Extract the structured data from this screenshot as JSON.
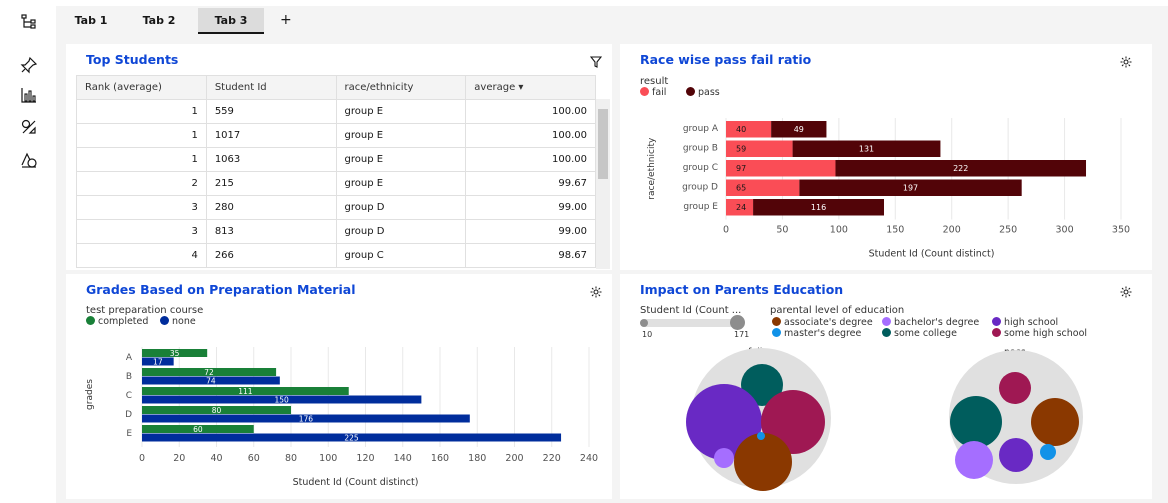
{
  "tabs": [
    {
      "label": "Tab 1"
    },
    {
      "label": "Tab 2"
    },
    {
      "label": "Tab 3"
    }
  ],
  "add_tab": "+",
  "top_students": {
    "title": "Top Students",
    "columns": [
      "Rank (average)",
      "Student Id",
      "race/ethnicity",
      "average ▾"
    ],
    "rows": [
      [
        "1",
        "559",
        "group E",
        "100.00"
      ],
      [
        "1",
        "1017",
        "group E",
        "100.00"
      ],
      [
        "1",
        "1063",
        "group E",
        "100.00"
      ],
      [
        "2",
        "215",
        "group E",
        "99.67"
      ],
      [
        "3",
        "280",
        "group D",
        "99.00"
      ],
      [
        "3",
        "813",
        "group D",
        "99.00"
      ],
      [
        "4",
        "266",
        "group C",
        "98.67"
      ]
    ]
  },
  "race_chart": {
    "title": "Race wise pass fail ratio",
    "legend_title": "result",
    "legend": [
      "fail",
      "pass"
    ]
  },
  "grades_chart": {
    "title": "Grades Based on Preparation Material",
    "legend_title": "test preparation course",
    "legend": [
      "completed",
      "none"
    ]
  },
  "parents_chart": {
    "title": "Impact on Parents Education",
    "slider_label": "Student Id (Count ...",
    "slider_min": "10",
    "slider_max": "171",
    "legend_title": "parental level of education",
    "legend": [
      "associate's degree",
      "bachelor's degree",
      "high school",
      "master's degree",
      "some college",
      "some high school"
    ],
    "facets": [
      "fail",
      "pass"
    ]
  },
  "colors": {
    "fail": "#fa4d56",
    "pass": "#520408",
    "completed": "#198038",
    "none": "#002d9c",
    "associate": "#8a3800",
    "bachelor": "#a56eff",
    "highschool": "#6929c4",
    "master": "#1192e8",
    "college": "#005d5d",
    "somehigh": "#9f1853",
    "title": "#0f47d6"
  },
  "icons": {
    "rail": [
      "data-tree-icon",
      "pin-icon",
      "bar-chart-icon",
      "shapes-icon",
      "dashboard-icon"
    ],
    "panel": [
      "filter-icon",
      "settings-icon"
    ]
  },
  "chart_data": [
    {
      "type": "bar",
      "title": "Race wise pass fail ratio",
      "orientation": "horizontal",
      "stacked": true,
      "categories": [
        "group A",
        "group B",
        "group C",
        "group D",
        "group E"
      ],
      "series": [
        {
          "name": "fail",
          "values": [
            40,
            59,
            97,
            65,
            24
          ]
        },
        {
          "name": "pass",
          "values": [
            49,
            131,
            222,
            197,
            116
          ]
        }
      ],
      "xlabel": "Student Id (Count distinct)",
      "ylabel": "race/ethnicity",
      "xlim": [
        0,
        350
      ],
      "xticks": [
        0,
        50,
        100,
        150,
        200,
        250,
        300,
        350
      ],
      "legend_title": "result",
      "legend_position": "top-left",
      "grid": true
    },
    {
      "type": "bar",
      "title": "Grades Based on Preparation Material",
      "orientation": "horizontal",
      "stacked": false,
      "categories": [
        "A",
        "B",
        "C",
        "D",
        "E"
      ],
      "series": [
        {
          "name": "completed",
          "values": [
            35,
            72,
            111,
            80,
            60
          ]
        },
        {
          "name": "none",
          "values": [
            17,
            74,
            150,
            176,
            225
          ]
        }
      ],
      "xlabel": "Student Id (Count distinct)",
      "ylabel": "grades",
      "xlim": [
        0,
        240
      ],
      "xticks": [
        0,
        20,
        40,
        60,
        80,
        100,
        120,
        140,
        160,
        180,
        200,
        220,
        240
      ],
      "legend_title": "test preparation course",
      "legend_position": "top-left",
      "grid": true
    }
  ]
}
